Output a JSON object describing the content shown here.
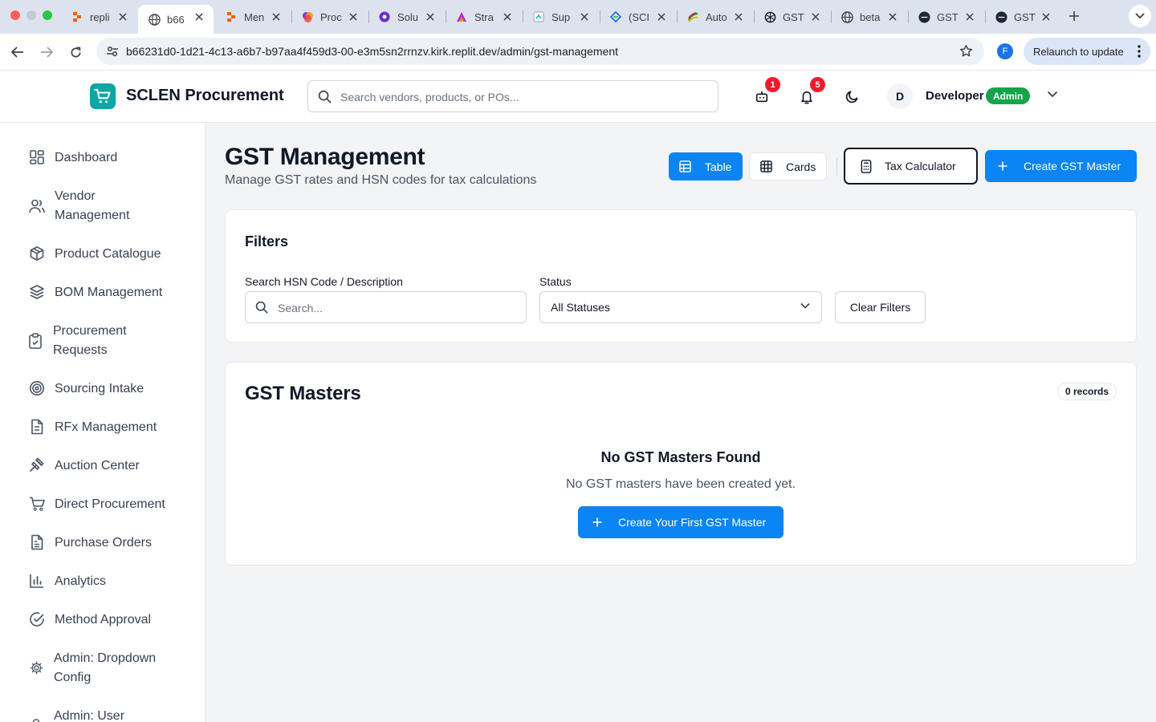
{
  "browser": {
    "tabs": [
      {
        "title": "repli",
        "favicon": "replit-icon"
      },
      {
        "title": "b66",
        "favicon": "globe-icon",
        "active": true
      },
      {
        "title": "Men",
        "favicon": "replit-icon"
      },
      {
        "title": "Proc",
        "favicon": "colorful-app-icon"
      },
      {
        "title": "Solu",
        "favicon": "purple-app-icon"
      },
      {
        "title": "Stra",
        "favicon": "gradient-app-icon"
      },
      {
        "title": "Sup",
        "favicon": "sheet-icon"
      },
      {
        "title": "(SCI",
        "favicon": "blue-diamond-icon"
      },
      {
        "title": "Auto",
        "favicon": "multicolor-icon"
      },
      {
        "title": "GST",
        "favicon": "openai-icon"
      },
      {
        "title": "beta",
        "favicon": "globe-icon"
      },
      {
        "title": "GST",
        "favicon": "clear-icon"
      },
      {
        "title": "GST",
        "favicon": "clear-icon"
      }
    ],
    "url": "b66231d0-1d21-4c13-a6b7-b97aa4f459d3-00-e3m5sn2rrnzv.kirk.replit.dev/admin/gst-management",
    "profile_initial": "F",
    "relaunch_label": "Relaunch to update"
  },
  "header": {
    "brand": "SCLEN Procurement",
    "search_placeholder": "Search vendors, products, or POs...",
    "cart_badge": "1",
    "notification_badge": "5",
    "avatar_initial": "D",
    "user_name": "Developer",
    "user_role": "Admin"
  },
  "sidebar": {
    "items": [
      {
        "label": "Dashboard",
        "icon": "dashboard-icon"
      },
      {
        "label": "Vendor Management",
        "icon": "users-icon"
      },
      {
        "label": "Product Catalogue",
        "icon": "package-icon"
      },
      {
        "label": "BOM Management",
        "icon": "layers-icon"
      },
      {
        "label": "Procurement Requests",
        "icon": "clipboard-icon"
      },
      {
        "label": "Sourcing Intake",
        "icon": "target-icon"
      },
      {
        "label": "RFx Management",
        "icon": "file-icon"
      },
      {
        "label": "Auction Center",
        "icon": "gavel-icon"
      },
      {
        "label": "Direct Procurement",
        "icon": "cart-icon"
      },
      {
        "label": "Purchase Orders",
        "icon": "file-text-icon"
      },
      {
        "label": "Analytics",
        "icon": "bar-chart-icon"
      },
      {
        "label": "Method Approval",
        "icon": "check-circle-icon"
      },
      {
        "label": "Admin: Dropdown Config",
        "icon": "gear-icon"
      },
      {
        "label": "Admin: User",
        "icon": "user-icon"
      }
    ]
  },
  "page": {
    "title": "GST Management",
    "subtitle": "Manage GST rates and HSN codes for tax calculations",
    "view_table_label": "Table",
    "view_cards_label": "Cards",
    "tax_calculator_label": "Tax Calculator",
    "create_label": "Create GST Master"
  },
  "filters": {
    "title": "Filters",
    "search_label": "Search HSN Code / Description",
    "search_placeholder": "Search...",
    "status_label": "Status",
    "status_value": "All Statuses",
    "clear_label": "Clear Filters"
  },
  "masters": {
    "title": "GST Masters",
    "records": "0 records",
    "empty_title": "No GST Masters Found",
    "empty_subtitle": "No GST masters have been created yet.",
    "create_first_label": "Create Your First GST Master"
  },
  "colors": {
    "primary": "#0b84f5",
    "badge": "#ef1b2d",
    "role": "#16a34a",
    "logo": "#0ea5a4"
  }
}
